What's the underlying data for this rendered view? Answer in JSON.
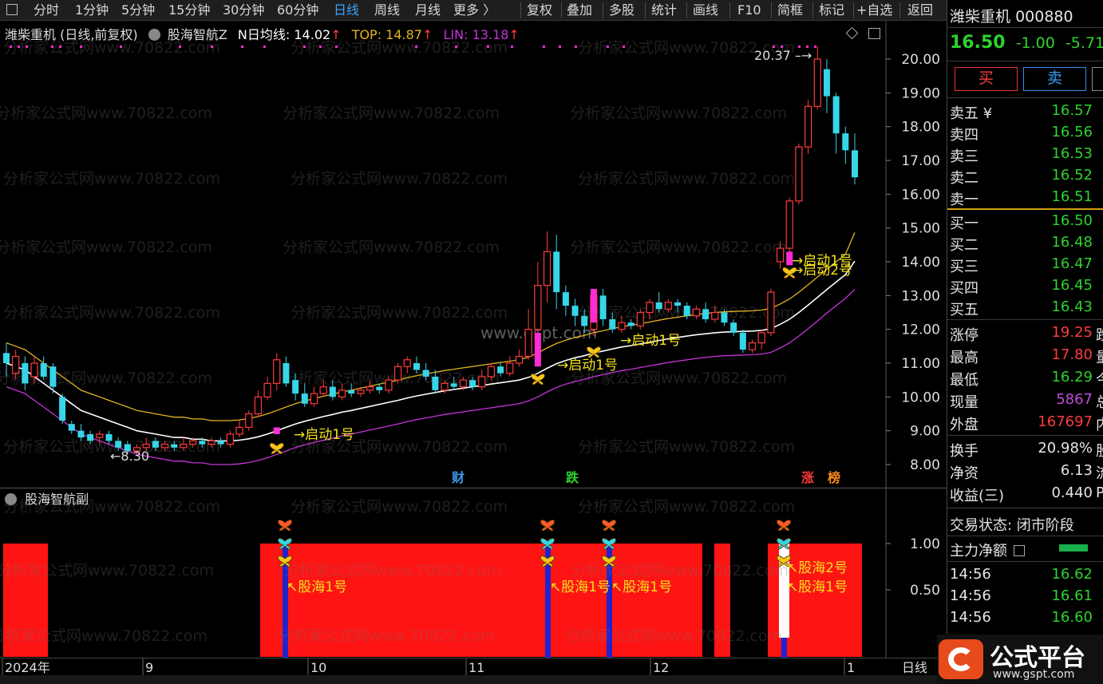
{
  "toolbar": {
    "periods": [
      "分时",
      "1分钟",
      "5分钟",
      "15分钟",
      "30分钟",
      "60分钟",
      "日线",
      "周线",
      "月线",
      "更多 〉"
    ],
    "active": "日线",
    "tools": [
      "复权",
      "叠加",
      "多股",
      "统计",
      "画线",
      "F10",
      "简框",
      "标记",
      "+自选",
      "返回"
    ]
  },
  "main_chart": {
    "title": "潍柴重机 (日线,前复权)",
    "indicator": "股海智航Z",
    "n_avg_label": "N日均线: 14.02",
    "top_label": "TOP: 14.87",
    "lin_label": "LIN: 13.18",
    "high_annotation": "20.37",
    "low_annotation": "8.30",
    "signal_labels": [
      "→启动1号",
      "→启动1号",
      "→启动1号",
      "→启动1号",
      "→启动2号"
    ],
    "event_tags": [
      "财",
      "跌",
      "涨",
      "榜"
    ],
    "watermark": "分析家公式网www.70822.com",
    "center_watermark": "www.gspt.com",
    "colors": {
      "up": "#ff3b3b",
      "down": "#37d5e8",
      "top": "#e2b422",
      "mid": "#ffffff",
      "lin": "#c434d8",
      "signal": "#f2e21b",
      "magenta": "#ff2bd5"
    }
  },
  "sub_chart": {
    "title": "股海智航副",
    "labels": [
      "股海1号",
      "股海1号",
      "股海1号",
      "股海2号",
      "股海1号"
    ]
  },
  "chart_data": {
    "type": "candlestick",
    "title": "潍柴重机 (日线,前复权)",
    "ylim": [
      7.6,
      20.6
    ],
    "y_ticks": [
      8.0,
      9.0,
      10.0,
      11.0,
      12.0,
      13.0,
      14.0,
      15.0,
      16.0,
      17.0,
      18.0,
      19.0,
      20.0
    ],
    "x_labels": [
      "2024年",
      "9",
      "10",
      "11",
      "12",
      "1"
    ],
    "sub_y_ticks": [
      1.0,
      0.5
    ],
    "candles": [
      [
        11.3,
        11.0,
        11.6,
        10.6
      ],
      [
        10.7,
        11.2,
        11.4,
        10.5
      ],
      [
        11.0,
        10.4,
        11.2,
        10.2
      ],
      [
        10.6,
        11.0,
        11.2,
        10.4
      ],
      [
        11.0,
        10.6,
        11.2,
        10.5
      ],
      [
        10.9,
        10.3,
        11.0,
        10.1
      ],
      [
        10.0,
        9.3,
        10.1,
        9.2
      ],
      [
        9.2,
        9.0,
        9.3,
        8.9
      ],
      [
        9.0,
        8.8,
        9.2,
        8.7
      ],
      [
        8.9,
        8.7,
        9.0,
        8.6
      ],
      [
        8.8,
        8.9,
        9.0,
        8.6
      ],
      [
        8.9,
        8.7,
        9.0,
        8.6
      ],
      [
        8.7,
        8.5,
        8.8,
        8.4
      ],
      [
        8.6,
        8.4,
        8.7,
        8.3
      ],
      [
        8.4,
        8.5,
        8.6,
        8.3
      ],
      [
        8.5,
        8.6,
        8.8,
        8.4
      ],
      [
        8.7,
        8.5,
        8.8,
        8.4
      ],
      [
        8.5,
        8.6,
        8.7,
        8.4
      ],
      [
        8.6,
        8.5,
        8.7,
        8.4
      ],
      [
        8.5,
        8.6,
        8.8,
        8.4
      ],
      [
        8.6,
        8.7,
        8.8,
        8.5
      ],
      [
        8.7,
        8.6,
        8.8,
        8.5
      ],
      [
        8.6,
        8.7,
        8.8,
        8.5
      ],
      [
        8.7,
        8.6,
        8.8,
        8.5
      ],
      [
        8.6,
        8.9,
        9.0,
        8.5
      ],
      [
        8.9,
        9.1,
        9.3,
        8.8
      ],
      [
        9.1,
        9.5,
        9.6,
        9.0
      ],
      [
        9.5,
        10.0,
        10.2,
        9.4
      ],
      [
        10.0,
        10.4,
        10.6,
        9.9
      ],
      [
        10.4,
        11.1,
        11.3,
        10.2
      ],
      [
        11.0,
        10.4,
        11.2,
        10.3
      ],
      [
        10.5,
        10.1,
        10.7,
        9.9
      ],
      [
        10.1,
        9.8,
        10.4,
        9.7
      ],
      [
        9.8,
        10.1,
        10.3,
        9.7
      ],
      [
        10.1,
        10.3,
        10.5,
        10.0
      ],
      [
        10.3,
        10.0,
        10.5,
        9.9
      ],
      [
        10.0,
        10.2,
        10.4,
        9.9
      ],
      [
        10.2,
        10.1,
        10.4,
        10.0
      ],
      [
        10.1,
        10.2,
        10.3,
        10.0
      ],
      [
        10.2,
        10.3,
        10.5,
        10.1
      ],
      [
        10.3,
        10.2,
        10.4,
        10.1
      ],
      [
        10.2,
        10.5,
        10.6,
        10.1
      ],
      [
        10.5,
        10.9,
        11.0,
        10.4
      ],
      [
        10.9,
        11.1,
        11.2,
        10.7
      ],
      [
        11.0,
        10.8,
        11.2,
        10.7
      ],
      [
        10.8,
        10.6,
        11.0,
        10.5
      ],
      [
        10.6,
        10.2,
        10.8,
        10.1
      ],
      [
        10.2,
        10.4,
        10.5,
        10.1
      ],
      [
        10.4,
        10.3,
        10.6,
        10.2
      ],
      [
        10.3,
        10.5,
        10.6,
        10.2
      ],
      [
        10.5,
        10.3,
        10.6,
        10.2
      ],
      [
        10.3,
        10.6,
        10.8,
        10.2
      ],
      [
        10.6,
        10.9,
        11.0,
        10.5
      ],
      [
        10.9,
        10.7,
        11.0,
        10.6
      ],
      [
        10.7,
        11.0,
        11.2,
        10.6
      ],
      [
        11.0,
        11.2,
        11.4,
        10.9
      ],
      [
        11.2,
        12.0,
        12.6,
        11.1
      ],
      [
        12.0,
        13.3,
        14.0,
        11.8
      ],
      [
        13.3,
        14.3,
        14.9,
        12.8
      ],
      [
        14.3,
        13.1,
        14.8,
        12.6
      ],
      [
        13.1,
        12.7,
        13.3,
        12.4
      ],
      [
        12.7,
        12.4,
        12.9,
        12.1
      ],
      [
        12.4,
        12.1,
        12.6,
        11.9
      ],
      [
        12.0,
        13.0,
        13.1,
        11.8
      ],
      [
        13.0,
        12.3,
        13.2,
        12.1
      ],
      [
        12.3,
        12.0,
        12.5,
        11.9
      ],
      [
        12.0,
        12.2,
        12.4,
        11.9
      ],
      [
        12.2,
        12.1,
        12.3,
        12.0
      ],
      [
        12.1,
        12.5,
        12.6,
        12.0
      ],
      [
        12.5,
        12.8,
        12.9,
        12.3
      ],
      [
        12.8,
        12.6,
        13.1,
        12.5
      ],
      [
        12.6,
        12.8,
        12.9,
        12.5
      ],
      [
        12.8,
        12.7,
        12.9,
        12.5
      ],
      [
        12.7,
        12.4,
        12.8,
        12.3
      ],
      [
        12.4,
        12.6,
        12.7,
        12.3
      ],
      [
        12.6,
        12.3,
        12.8,
        12.2
      ],
      [
        12.3,
        12.5,
        12.7,
        12.2
      ],
      [
        12.5,
        12.2,
        12.6,
        12.1
      ],
      [
        12.2,
        11.9,
        12.3,
        11.8
      ],
      [
        11.9,
        11.4,
        12.0,
        11.3
      ],
      [
        11.4,
        11.6,
        11.7,
        11.3
      ],
      [
        11.6,
        11.9,
        12.0,
        11.4
      ],
      [
        11.9,
        13.1,
        13.2,
        11.8
      ],
      [
        14.0,
        14.4,
        14.6,
        13.8
      ],
      [
        14.4,
        15.8,
        15.9,
        14.3
      ],
      [
        15.8,
        17.4,
        17.5,
        15.7
      ],
      [
        17.4,
        18.6,
        18.8,
        17.2
      ],
      [
        18.6,
        20.0,
        20.37,
        18.5
      ],
      [
        19.7,
        18.9,
        20.0,
        18.4
      ],
      [
        18.9,
        17.8,
        19.0,
        17.2
      ],
      [
        17.8,
        17.3,
        18.0,
        16.9
      ],
      [
        17.3,
        16.5,
        17.8,
        16.29
      ]
    ],
    "series": [
      {
        "name": "N日均线",
        "values": [
          11.0,
          10.9,
          10.8,
          10.6,
          10.4,
          10.2,
          10.0,
          9.8,
          9.6,
          9.5,
          9.4,
          9.3,
          9.2,
          9.1,
          9.0,
          8.95,
          8.9,
          8.85,
          8.8,
          8.8,
          8.75,
          8.75,
          8.7,
          8.7,
          8.7,
          8.72,
          8.76,
          8.82,
          8.9,
          9.0,
          9.1,
          9.2,
          9.28,
          9.35,
          9.42,
          9.48,
          9.55,
          9.6,
          9.66,
          9.72,
          9.78,
          9.84,
          9.9,
          9.97,
          10.03,
          10.08,
          10.13,
          10.18,
          10.22,
          10.26,
          10.3,
          10.34,
          10.38,
          10.42,
          10.46,
          10.5,
          10.58,
          10.7,
          10.85,
          10.98,
          11.08,
          11.16,
          11.22,
          11.3,
          11.36,
          11.42,
          11.48,
          11.52,
          11.57,
          11.62,
          11.67,
          11.72,
          11.76,
          11.8,
          11.84,
          11.87,
          11.9,
          11.92,
          11.93,
          11.94,
          11.95,
          11.97,
          12.02,
          12.15,
          12.3,
          12.5,
          12.72,
          12.95,
          13.18,
          13.4,
          13.62,
          14.02
        ]
      },
      {
        "name": "TOP",
        "values": [
          11.6,
          11.5,
          11.4,
          11.2,
          11.0,
          10.8,
          10.6,
          10.4,
          10.2,
          10.1,
          10.0,
          9.9,
          9.8,
          9.7,
          9.6,
          9.55,
          9.5,
          9.45,
          9.4,
          9.4,
          9.35,
          9.35,
          9.3,
          9.3,
          9.3,
          9.32,
          9.36,
          9.42,
          9.5,
          9.6,
          9.7,
          9.8,
          9.88,
          9.95,
          10.02,
          10.08,
          10.15,
          10.2,
          10.26,
          10.32,
          10.38,
          10.44,
          10.5,
          10.57,
          10.63,
          10.68,
          10.73,
          10.78,
          10.82,
          10.86,
          10.9,
          10.94,
          10.98,
          11.02,
          11.06,
          11.1,
          11.18,
          11.3,
          11.45,
          11.58,
          11.68,
          11.76,
          11.82,
          11.9,
          11.96,
          12.02,
          12.08,
          12.12,
          12.17,
          12.22,
          12.27,
          12.32,
          12.36,
          12.4,
          12.44,
          12.47,
          12.5,
          12.52,
          12.53,
          12.54,
          12.55,
          12.57,
          12.62,
          12.75,
          12.9,
          13.1,
          13.32,
          13.55,
          13.78,
          14.0,
          14.22,
          14.87
        ]
      },
      {
        "name": "LIN",
        "values": [
          10.3,
          10.2,
          10.1,
          9.9,
          9.7,
          9.5,
          9.3,
          9.1,
          8.9,
          8.8,
          8.7,
          8.6,
          8.5,
          8.4,
          8.3,
          8.25,
          8.2,
          8.15,
          8.1,
          8.1,
          8.05,
          8.05,
          8.0,
          8.0,
          8.0,
          8.02,
          8.06,
          8.12,
          8.2,
          8.3,
          8.4,
          8.5,
          8.58,
          8.65,
          8.72,
          8.78,
          8.85,
          8.9,
          8.96,
          9.02,
          9.08,
          9.14,
          9.2,
          9.27,
          9.33,
          9.38,
          9.43,
          9.48,
          9.52,
          9.56,
          9.6,
          9.64,
          9.68,
          9.72,
          9.76,
          9.8,
          9.88,
          10.0,
          10.15,
          10.28,
          10.38,
          10.46,
          10.52,
          10.6,
          10.66,
          10.72,
          10.78,
          10.82,
          10.87,
          10.92,
          10.97,
          11.02,
          11.06,
          11.1,
          11.14,
          11.17,
          11.2,
          11.22,
          11.23,
          11.24,
          11.25,
          11.27,
          11.32,
          11.45,
          11.6,
          11.8,
          12.02,
          12.25,
          12.48,
          12.7,
          12.92,
          13.18
        ]
      }
    ]
  },
  "right_panel": {
    "stock_name": "潍柴重机",
    "stock_code": "000880",
    "price": "16.50",
    "change": "-1.00",
    "change_pct": "-5.71",
    "buy_label": "买",
    "sell_label": "卖",
    "asks": [
      {
        "label": "卖五 ¥",
        "price": "16.57"
      },
      {
        "label": "卖四",
        "price": "16.56"
      },
      {
        "label": "卖三",
        "price": "16.53"
      },
      {
        "label": "卖二",
        "price": "16.52"
      },
      {
        "label": "卖一",
        "price": "16.51"
      }
    ],
    "bids": [
      {
        "label": "买一",
        "price": "16.50"
      },
      {
        "label": "买二",
        "price": "16.48"
      },
      {
        "label": "买三",
        "price": "16.47"
      },
      {
        "label": "买四",
        "price": "16.45"
      },
      {
        "label": "买五",
        "price": "16.43"
      }
    ],
    "stats": [
      {
        "label": "涨停",
        "value": "19.25",
        "color": "red",
        "tail": "跌"
      },
      {
        "label": "最高",
        "value": "17.80",
        "color": "red",
        "tail": "量"
      },
      {
        "label": "最低",
        "value": "16.29",
        "color": "green",
        "tail": "今"
      },
      {
        "label": "现量",
        "value": "5867",
        "color": "purple",
        "tail": "总"
      },
      {
        "label": "外盘",
        "value": "167697",
        "color": "red",
        "tail": "内"
      }
    ],
    "stats2": [
      {
        "label": "换手",
        "value": "20.98%",
        "tail": "股"
      },
      {
        "label": "净资",
        "value": "6.13",
        "tail": "流"
      },
      {
        "label": "收益(三)",
        "value": "0.440",
        "tail": "P"
      }
    ],
    "trade_status": "交易状态: 闭市阶段",
    "main_flow": "主力净额",
    "ticks": [
      {
        "time": "14:56",
        "price": "16.62"
      },
      {
        "time": "14:56",
        "price": "16.61"
      },
      {
        "time": "14:56",
        "price": "16.60"
      }
    ],
    "bottom_tab": "日线"
  },
  "logo": {
    "text": "公式平台",
    "url_text": "www.gspt.com"
  }
}
